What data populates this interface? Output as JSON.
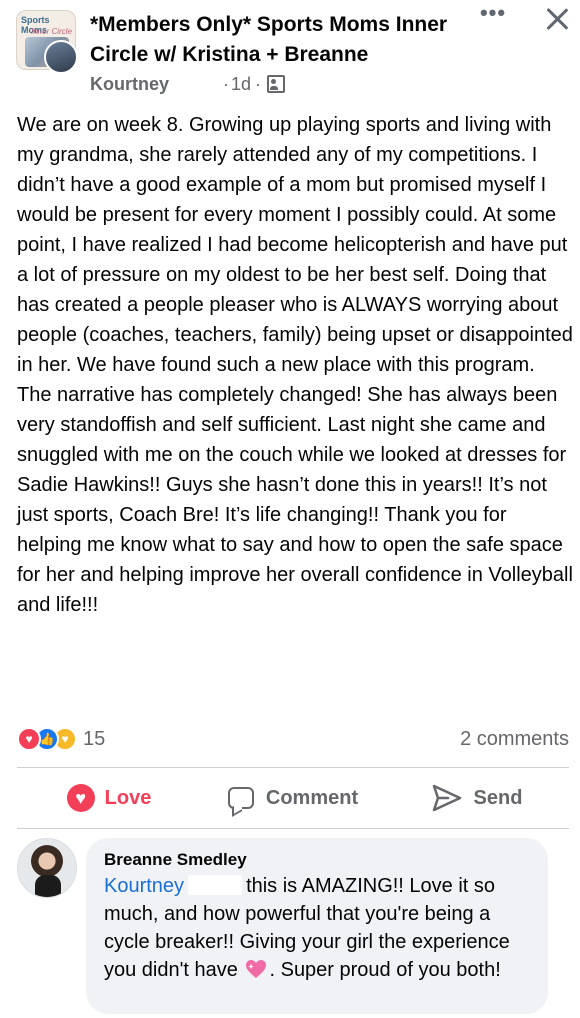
{
  "post": {
    "group_name": "*Members Only* Sports Moms Inner Circle w/ Kristina + Breanne",
    "group_avatar_text": "Sports Moms",
    "group_avatar_subtext": "Inner Circle",
    "author": "Kourtney",
    "time": "1d",
    "dot": "·",
    "body": "We are on week 8. Growing up playing sports and living with my grandma, she rarely attended any of my competitions. I didn’t have a good example of a mom but promised myself I would be present for every moment I possibly could. At some point, I have realized I had become helicopterish and have put a lot of pressure on my oldest to be her best self. Doing that has created a people pleaser who is ALWAYS worrying about people (coaches, teachers, family) being upset or disappointed in her. We have found such a new place with this program. The narrative has completely changed!  She has always been very standoffish and self sufficient. Last night she came and snuggled with me on the couch while we looked at dresses for Sadie Hawkins!!  Guys she hasn’t done this in years!!  It’s not just sports, Coach Bre!  It’s life changing!!  Thank you for helping me know what to say and how to open the safe space for her and helping improve her overall confidence in Volleyball and life!!!"
  },
  "icons": {
    "more": "more-options-icon",
    "close": "close-icon",
    "privacy": "group-privacy-icon",
    "heart": "heart-icon",
    "comment": "comment-icon",
    "send": "send-icon"
  },
  "reactions": {
    "count": "15",
    "comments_label": "2 comments",
    "types": [
      "love",
      "like",
      "care"
    ]
  },
  "actions": {
    "love_label": "Love",
    "comment_label": "Comment",
    "send_label": "Send"
  },
  "comment": {
    "author": "Breanne Smedley",
    "mention": "Kourtney",
    "text_part1": "this is AMAZING!! Love it so much, and how powerful that you're being a cycle breaker!! Giving your girl the experience you didn't have",
    "text_part2": ". Super proud of you both!"
  },
  "colors": {
    "love": "#f33e58",
    "like": "#1877f2",
    "care": "#f7b928",
    "mention": "#1a6fd6",
    "secondary_text": "#65676b",
    "bubble": "#f0f2f5"
  }
}
